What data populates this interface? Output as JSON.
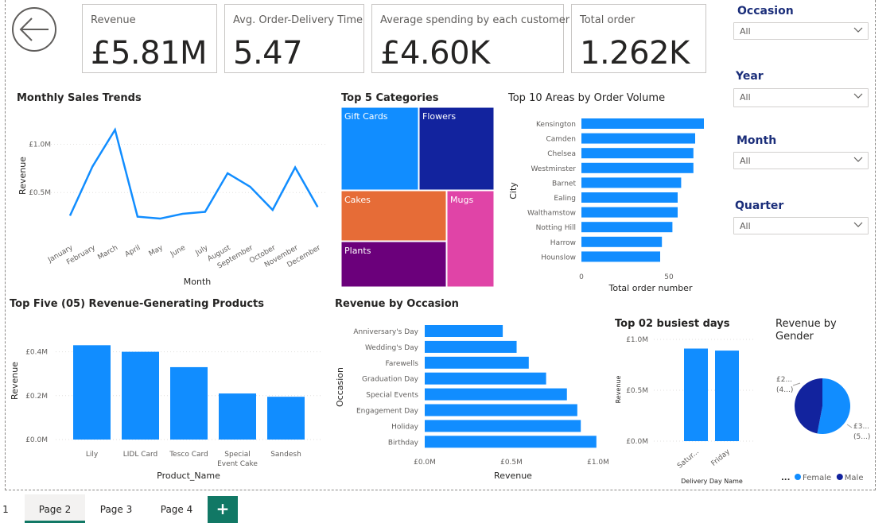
{
  "cards": [
    {
      "label": "Revenue",
      "value": "£5.81M"
    },
    {
      "label": "Avg. Order-Delivery Time",
      "value": "5.47"
    },
    {
      "label": "Average spending by each customer",
      "value": "£4.60K"
    },
    {
      "label": "Total order",
      "value": "1.262K"
    }
  ],
  "slicers": [
    {
      "title": "Occasion",
      "value": "All"
    },
    {
      "title": "Year",
      "value": "All"
    },
    {
      "title": "Month",
      "value": "All"
    },
    {
      "title": "Quarter",
      "value": "All"
    }
  ],
  "tabs": {
    "first": "1",
    "items": [
      "Page 2",
      "Page 3",
      "Page 4"
    ],
    "add_label": "+"
  },
  "chart_data": [
    {
      "id": "monthly",
      "type": "line",
      "title": "Monthly Sales Trends",
      "xlabel": "Month",
      "ylabel": "Revenue",
      "categories": [
        "January",
        "February",
        "March",
        "April",
        "May",
        "June",
        "July",
        "August",
        "September",
        "October",
        "November",
        "December"
      ],
      "values": [
        0.26,
        0.77,
        1.15,
        0.25,
        0.23,
        0.28,
        0.3,
        0.7,
        0.56,
        0.32,
        0.76,
        0.35
      ],
      "ylim": [
        0,
        1.3
      ],
      "yticks": [
        {
          "v": 0.5,
          "label": "£0.5M"
        },
        {
          "v": 1.0,
          "label": "£1.0M"
        }
      ],
      "color": "#118dff"
    },
    {
      "id": "treemap",
      "type": "treemap",
      "title": "Top 5 Categories",
      "items": [
        {
          "name": "Gift Cards",
          "color": "#118dff"
        },
        {
          "name": "Flowers",
          "color": "#12239e"
        },
        {
          "name": "Cakes",
          "color": "#e66c37"
        },
        {
          "name": "Mugs",
          "color": "#e044a7"
        },
        {
          "name": "Plants",
          "color": "#6b007b"
        }
      ]
    },
    {
      "id": "areas",
      "type": "bar",
      "orientation": "horizontal",
      "title": "Top 10 Areas by Order Volume",
      "xlabel": "Total order number",
      "ylabel": "City",
      "categories": [
        "Kensington",
        "Camden",
        "Chelsea",
        "Westminster",
        "Barnet",
        "Ealing",
        "Walthamstow",
        "Notting Hill",
        "Harrow",
        "Hounslow"
      ],
      "values": [
        70,
        65,
        64,
        64,
        57,
        55,
        55,
        52,
        46,
        45
      ],
      "xlim": [
        0,
        75
      ],
      "xticks": [
        {
          "v": 0,
          "label": "0"
        },
        {
          "v": 50,
          "label": "50"
        }
      ],
      "color": "#118dff"
    },
    {
      "id": "products",
      "type": "bar",
      "title": "Top Five (05) Revenue-Generating Products",
      "xlabel": "Product_Name",
      "ylabel": "Revenue",
      "categories": [
        "Lily",
        "LIDL Card",
        "Tesco Card",
        "Special Event Cake",
        "Sandesh"
      ],
      "values": [
        0.43,
        0.4,
        0.33,
        0.21,
        0.195
      ],
      "ylim": [
        0,
        0.5
      ],
      "yticks": [
        {
          "v": 0,
          "label": "£0.0M"
        },
        {
          "v": 0.2,
          "label": "£0.2M"
        },
        {
          "v": 0.4,
          "label": "£0.4M"
        }
      ],
      "color": "#118dff"
    },
    {
      "id": "occasion",
      "type": "bar",
      "orientation": "horizontal",
      "title": "Revenue by Occasion",
      "xlabel": "Revenue",
      "ylabel": "Occasion",
      "categories": [
        "Anniversary's Day",
        "Wedding's Day",
        "Farewells",
        "Graduation Day",
        "Special Events",
        "Engagement Day",
        "Holiday",
        "Birthday"
      ],
      "values": [
        0.45,
        0.53,
        0.6,
        0.7,
        0.82,
        0.88,
        0.9,
        0.99
      ],
      "xlim": [
        0,
        1.0
      ],
      "xticks": [
        {
          "v": 0,
          "label": "£0.0M"
        },
        {
          "v": 0.5,
          "label": "£0.5M"
        },
        {
          "v": 1.0,
          "label": "£1.0M"
        }
      ],
      "color": "#118dff"
    },
    {
      "id": "days",
      "type": "bar",
      "title": "Top 02 busiest days",
      "xlabel": "Delivery Day Name",
      "ylabel": "Revenue",
      "categories": [
        "Satur...",
        "Friday"
      ],
      "values": [
        0.91,
        0.89
      ],
      "ylim": [
        0,
        1.0
      ],
      "yticks": [
        {
          "v": 0,
          "label": "£0.0M"
        },
        {
          "v": 0.5,
          "label": "£0.5M"
        },
        {
          "v": 1.0,
          "label": "£1.0M"
        }
      ],
      "color": "#118dff"
    },
    {
      "id": "gender",
      "type": "pie",
      "title": "Revenue by Gender",
      "slices": [
        {
          "name": "Female",
          "value": 53,
          "label1": "£3...",
          "label2": "(5...)",
          "color": "#118dff"
        },
        {
          "name": "Male",
          "value": 47,
          "label1": "£2...",
          "label2": "(4...)",
          "color": "#12239e"
        }
      ],
      "legend_more": "..."
    }
  ]
}
